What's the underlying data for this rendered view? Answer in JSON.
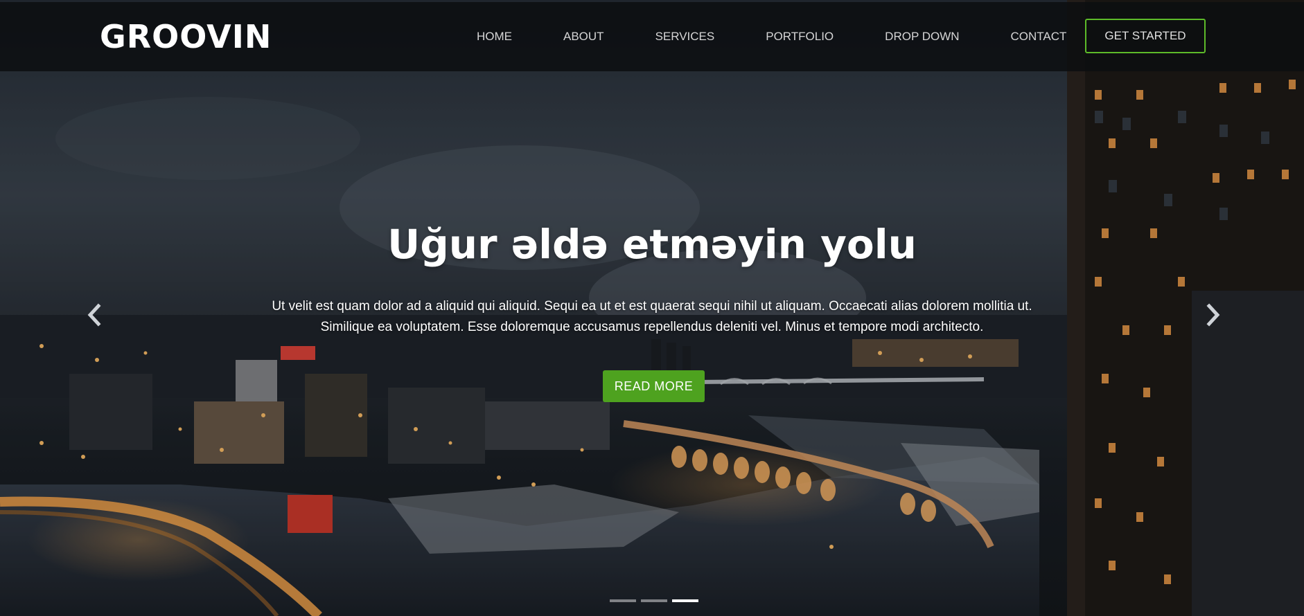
{
  "brand": {
    "logo": "GROOVIN"
  },
  "nav": {
    "items": [
      {
        "label": "HOME"
      },
      {
        "label": "ABOUT"
      },
      {
        "label": "SERVICES"
      },
      {
        "label": "PORTFOLIO"
      },
      {
        "label": "DROP DOWN"
      },
      {
        "label": "CONTACT"
      }
    ],
    "cta_label": "GET STARTED"
  },
  "hero": {
    "headline": "Uğur əldə etməyin yolu",
    "subtext": "Ut velit est quam dolor ad a aliquid qui aliquid. Sequi ea ut et est quaerat sequi nihil ut aliquam. Occaecati alias dolorem mollitia ut. Similique ea voluptatem. Esse doloremque accusamus repellendus deleniti vel. Minus et tempore modi architecto.",
    "button_label": "READ MORE"
  },
  "carousel": {
    "prev_icon": "chevron-left-icon",
    "next_icon": "chevron-right-icon",
    "indicator_count": 3,
    "active_index": 2
  },
  "colors": {
    "accent_green": "#4ea21f",
    "cta_border": "#5dbb29",
    "navbar_bg": "#0c0e10"
  }
}
